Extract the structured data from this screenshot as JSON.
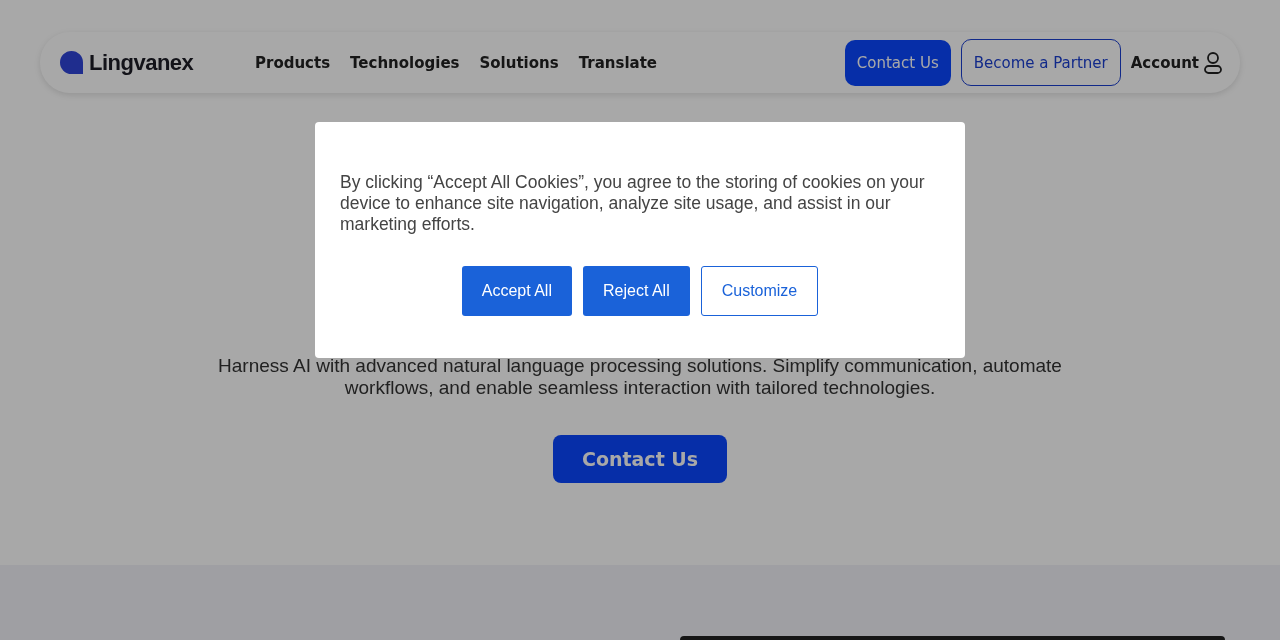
{
  "header": {
    "logo": "Lingvanex",
    "nav": [
      "Products",
      "Technologies",
      "Solutions",
      "Translate"
    ],
    "contact_button": "Contact Us",
    "partner_button": "Become a Partner",
    "account": "Account"
  },
  "hero": {
    "subtitle": "Harness AI with advanced natural language processing solutions. Simplify communication, automate workflows, and enable seamless interaction with tailored technologies.",
    "button": "Contact Us"
  },
  "cookie_dialog": {
    "text": "By clicking “Accept All Cookies”, you agree to the storing of cookies on your device to enhance site navigation, analyze site usage, and assist in our marketing efforts.",
    "buttons": [
      {
        "label": "Accept All",
        "kind": "filled"
      },
      {
        "label": "Reject All",
        "kind": "filled"
      },
      {
        "label": "Customize",
        "kind": "outline"
      }
    ]
  }
}
